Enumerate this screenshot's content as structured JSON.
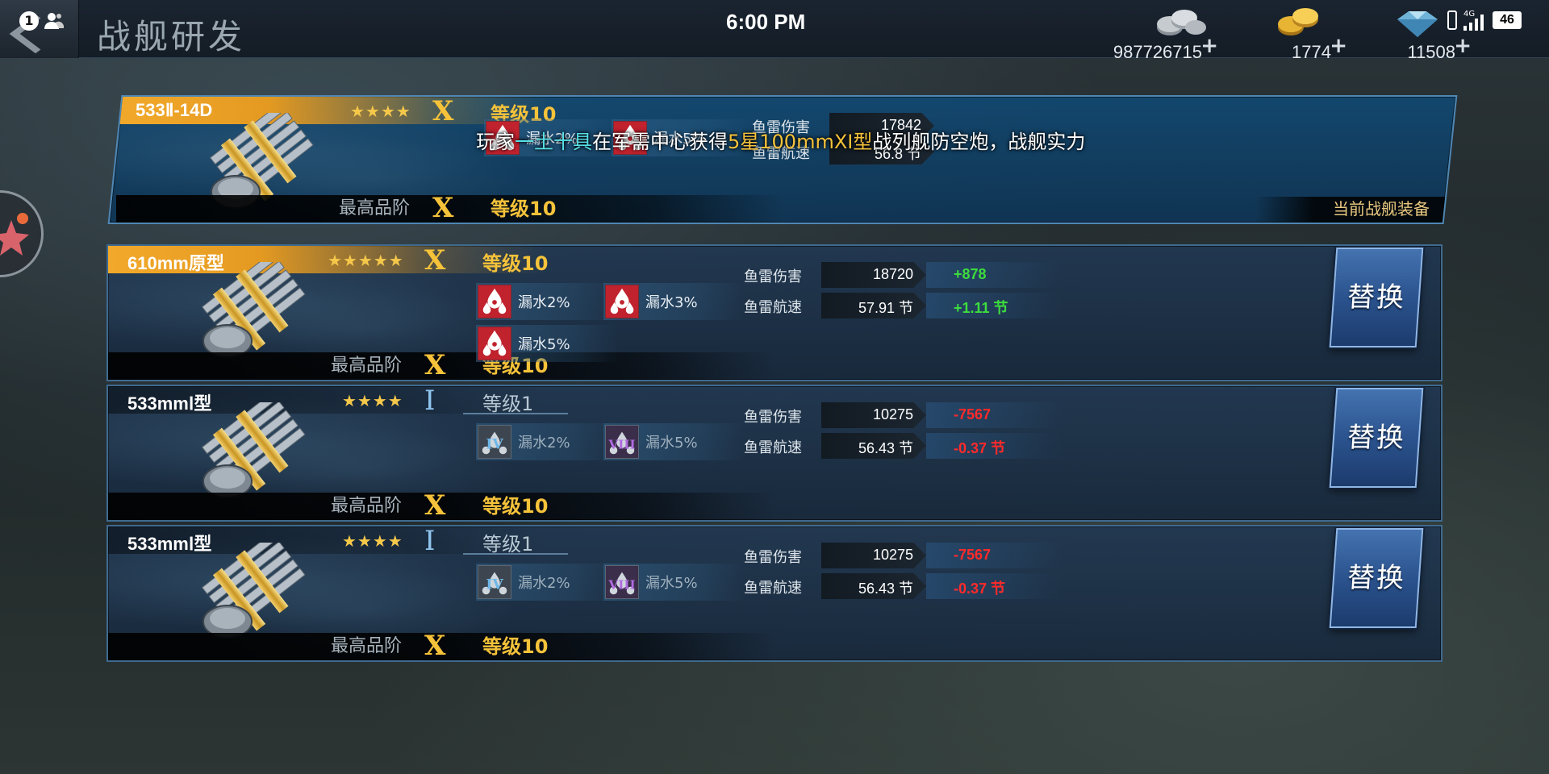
{
  "header": {
    "title": "战舰研发",
    "clock": "6:00 PM",
    "notification_count": "1",
    "currencies": [
      {
        "icon": "silver-coins-icon",
        "amount": "987726715"
      },
      {
        "icon": "gold-coins-icon",
        "amount": "1774"
      },
      {
        "icon": "diamond-icon",
        "amount": "11508"
      }
    ],
    "plus_label": "+",
    "phone_status": {
      "network": "4G",
      "battery": "46"
    }
  },
  "marquee": {
    "prefix": "玩家",
    "player": "一土十具",
    "mid": "在军需中心获得",
    "item": "5星100mmⅩⅠ型",
    "suffix": "战列舰防空炮，战舰实力"
  },
  "items": [
    {
      "name": "533Ⅱ-14D",
      "stars": "★★★★",
      "rank": "X",
      "level": "等级10",
      "max_label": "最高品阶",
      "max_rank": "X",
      "max_level": "等级10",
      "current": true,
      "current_label": "当前战舰装备",
      "skills": [
        {
          "icon": "leak-icon",
          "label": "漏水2%"
        },
        {
          "icon": "leak-icon",
          "label": "漏水5%"
        }
      ],
      "stats": [
        {
          "label": "鱼雷伤害",
          "value": "17842",
          "diff": ""
        },
        {
          "label": "鱼雷航速",
          "value": "56.8 节",
          "diff": ""
        }
      ]
    },
    {
      "name": "610mm原型",
      "stars": "★★★★★",
      "rank": "X",
      "level": "等级10",
      "max_label": "最高品阶",
      "max_rank": "X",
      "max_level": "等级10",
      "current": false,
      "replace_label": "替换",
      "skills": [
        {
          "icon": "leak-icon",
          "label": "漏水2%"
        },
        {
          "icon": "leak-icon",
          "label": "漏水3%"
        },
        {
          "icon": "leak-icon",
          "label": "漏水5%"
        }
      ],
      "stats": [
        {
          "label": "鱼雷伤害",
          "value": "18720",
          "diff": "+878",
          "diff_color": "#3ddc3d"
        },
        {
          "label": "鱼雷航速",
          "value": "57.91 节",
          "diff": "+1.11 节",
          "diff_color": "#3ddc3d"
        }
      ]
    },
    {
      "name": "533mmⅠ型",
      "stars": "★★★★",
      "rank": "I",
      "level": "等级1",
      "max_label": "最高品阶",
      "max_rank": "X",
      "max_level": "等级10",
      "current": false,
      "replace_label": "替换",
      "skills": [
        {
          "icon": "locked-leak-icon-4",
          "label": "漏水2%"
        },
        {
          "icon": "locked-leak-icon-8",
          "label": "漏水5%"
        }
      ],
      "stats": [
        {
          "label": "鱼雷伤害",
          "value": "10275",
          "diff": "-7567",
          "diff_color": "#ff2a2a"
        },
        {
          "label": "鱼雷航速",
          "value": "56.43 节",
          "diff": "-0.37 节",
          "diff_color": "#ff2a2a"
        }
      ]
    },
    {
      "name": "533mmⅠ型",
      "stars": "★★★★",
      "rank": "I",
      "level": "等级1",
      "max_label": "最高品阶",
      "max_rank": "X",
      "max_level": "等级10",
      "current": false,
      "replace_label": "替换",
      "skills": [
        {
          "icon": "locked-leak-icon-4",
          "label": "漏水2%"
        },
        {
          "icon": "locked-leak-icon-8",
          "label": "漏水5%"
        }
      ],
      "stats": [
        {
          "label": "鱼雷伤害",
          "value": "10275",
          "diff": "-7567",
          "diff_color": "#ff2a2a"
        },
        {
          "label": "鱼雷航速",
          "value": "56.43 节",
          "diff": "-0.37 节",
          "diff_color": "#ff2a2a"
        }
      ]
    }
  ]
}
